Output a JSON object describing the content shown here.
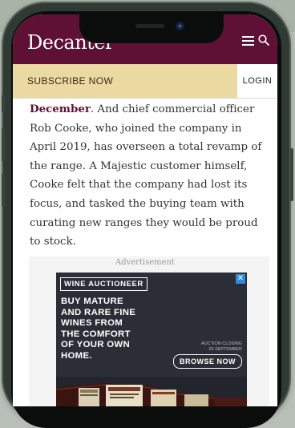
{
  "site": {
    "logo": "Decanter"
  },
  "header": {
    "menu_icon": "hamburger-menu-icon",
    "search_icon": "search-icon",
    "background": "#5e1134"
  },
  "subscribe_bar": {
    "subscribe_label": "SUBSCRIBE NOW",
    "login_label": "LOGIN",
    "background": "#ead9a0"
  },
  "article": {
    "lead": "December",
    "body": ". And chief commercial officer Rob Cooke, who joined the company in April 2019, has overseen a total revamp of the range. A Majestic customer himself, Cooke felt that the company had lost its focus, and tasked the buying team with curating new ranges they would be proud to stock."
  },
  "ad": {
    "label": "Advertisement",
    "brand": "WINE AUCTIONEER",
    "headline": "BUY MATURE\nAND RARE FINE\nWINES FROM\nTHE COMFORT\nOF YOUR OWN\nHOME.",
    "closing": "AUCTION CLOSING\n25 SEPTEMBER",
    "cta": "BROWSE NOW",
    "close_symbol": "✕",
    "close_icon": "ad-close-icon"
  }
}
